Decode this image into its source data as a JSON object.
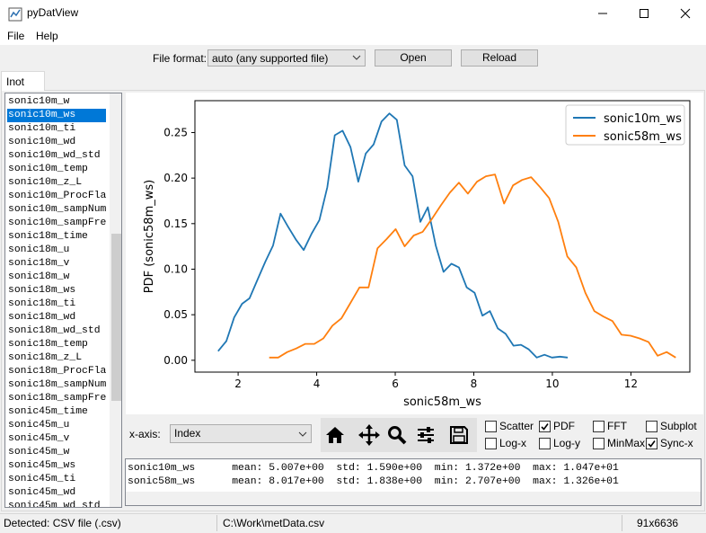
{
  "window": {
    "title": "pyDatView"
  },
  "menu": {
    "file": "File",
    "help": "Help"
  },
  "toolbar": {
    "file_format_label": "File format:",
    "file_format_value": "auto (any supported file)",
    "open_label": "Open",
    "reload_label": "Reload"
  },
  "tab": {
    "label": "Inot"
  },
  "columns": {
    "items": [
      "sonic10m_w",
      "sonic10m_ws",
      "sonic10m_ti",
      "sonic10m_wd",
      "sonic10m_wd_std",
      "sonic10m_temp",
      "sonic10m_z_L",
      "sonic10m_ProcFla",
      "sonic10m_sampNum",
      "sonic10m_sampFre",
      "sonic18m_time",
      "sonic18m_u",
      "sonic18m_v",
      "sonic18m_w",
      "sonic18m_ws",
      "sonic18m_ti",
      "sonic18m_wd",
      "sonic18m_wd_std",
      "sonic18m_temp",
      "sonic18m_z_L",
      "sonic18m_ProcFla",
      "sonic18m_sampNum",
      "sonic18m_sampFre",
      "sonic45m_time",
      "sonic45m_u",
      "sonic45m_v",
      "sonic45m_w",
      "sonic45m_ws",
      "sonic45m_ti",
      "sonic45m_wd",
      "sonic45m_wd_std"
    ],
    "selected": "sonic10m_ws"
  },
  "chart_data": {
    "type": "line",
    "xlabel": "sonic58m_ws",
    "ylabel": "PDF (sonic58m_ws)",
    "xlim": [
      0.9,
      13.5
    ],
    "ylim": [
      -0.013,
      0.285
    ],
    "xticks": [
      2,
      4,
      6,
      8,
      10,
      12
    ],
    "yticks": [
      0.0,
      0.05,
      0.1,
      0.15,
      0.2,
      0.25
    ],
    "ytick_labels": [
      "0.00",
      "0.05",
      "0.10",
      "0.15",
      "0.20",
      "0.25"
    ],
    "legend_position": "top-right",
    "grid": false,
    "series": [
      {
        "name": "sonic10m_ws",
        "color": "#1f77b4",
        "x": [
          1.49,
          1.7,
          1.9,
          2.1,
          2.29,
          2.49,
          2.69,
          2.89,
          3.08,
          3.28,
          3.48,
          3.67,
          3.87,
          4.07,
          4.27,
          4.46,
          4.66,
          4.86,
          5.06,
          5.25,
          5.45,
          5.65,
          5.85,
          6.04,
          6.24,
          6.44,
          6.64,
          6.83,
          7.03,
          7.23,
          7.43,
          7.62,
          7.82,
          8.02,
          8.22,
          8.41,
          8.61,
          8.81,
          9.01,
          9.2,
          9.4,
          9.6,
          9.8,
          9.99,
          10.19,
          10.39
        ],
        "y": [
          0.01,
          0.021,
          0.047,
          0.062,
          0.068,
          0.088,
          0.108,
          0.126,
          0.161,
          0.146,
          0.132,
          0.121,
          0.139,
          0.154,
          0.19,
          0.247,
          0.252,
          0.234,
          0.196,
          0.227,
          0.237,
          0.262,
          0.271,
          0.264,
          0.214,
          0.202,
          0.152,
          0.168,
          0.126,
          0.097,
          0.106,
          0.102,
          0.08,
          0.074,
          0.049,
          0.054,
          0.035,
          0.029,
          0.016,
          0.017,
          0.012,
          0.003,
          0.006,
          0.003,
          0.004,
          0.003
        ]
      },
      {
        "name": "sonic58m_ws",
        "color": "#ff7f0e",
        "x": [
          2.79,
          3.02,
          3.25,
          3.48,
          3.71,
          3.94,
          4.17,
          4.4,
          4.63,
          4.86,
          5.09,
          5.32,
          5.55,
          5.78,
          6.01,
          6.24,
          6.47,
          6.7,
          6.93,
          7.16,
          7.39,
          7.62,
          7.85,
          8.08,
          8.31,
          8.54,
          8.77,
          9.0,
          9.23,
          9.46,
          9.69,
          9.92,
          10.15,
          10.38,
          10.61,
          10.84,
          11.07,
          11.3,
          11.53,
          11.76,
          11.99,
          12.22,
          12.45,
          12.68,
          12.91,
          13.14
        ],
        "y": [
          0.003,
          0.003,
          0.009,
          0.013,
          0.018,
          0.018,
          0.024,
          0.038,
          0.046,
          0.063,
          0.08,
          0.08,
          0.123,
          0.133,
          0.144,
          0.125,
          0.137,
          0.141,
          0.155,
          0.17,
          0.184,
          0.195,
          0.183,
          0.196,
          0.202,
          0.204,
          0.172,
          0.192,
          0.198,
          0.201,
          0.19,
          0.178,
          0.152,
          0.114,
          0.102,
          0.074,
          0.054,
          0.048,
          0.043,
          0.028,
          0.027,
          0.024,
          0.02,
          0.005,
          0.009,
          0.003
        ]
      }
    ]
  },
  "controls": {
    "xaxis_label": "x-axis:",
    "xaxis_value": "Index",
    "icons": [
      "home-icon",
      "pan-icon",
      "zoom-icon",
      "sliders-icon",
      "save-icon"
    ],
    "checkboxes": {
      "scatter": {
        "label": "Scatter",
        "checked": false
      },
      "pdf": {
        "label": "PDF",
        "checked": true
      },
      "fft": {
        "label": "FFT",
        "checked": false
      },
      "subplot": {
        "label": "Subplot",
        "checked": false
      },
      "logx": {
        "label": "Log-x",
        "checked": false
      },
      "logy": {
        "label": "Log-y",
        "checked": false
      },
      "minmax": {
        "label": "MinMax",
        "checked": false
      },
      "syncx": {
        "label": "Sync-x",
        "checked": true
      }
    }
  },
  "info": {
    "line1": "sonic10m_ws      mean: 5.007e+00  std: 1.590e+00  min: 1.372e+00  max: 1.047e+01",
    "line2": "sonic58m_ws      mean: 8.017e+00  std: 1.838e+00  min: 2.707e+00  max: 1.326e+01"
  },
  "status": {
    "detected": "Detected: CSV file (.csv)",
    "path": "C:\\Work\\metData.csv",
    "dims": "91x6636"
  }
}
